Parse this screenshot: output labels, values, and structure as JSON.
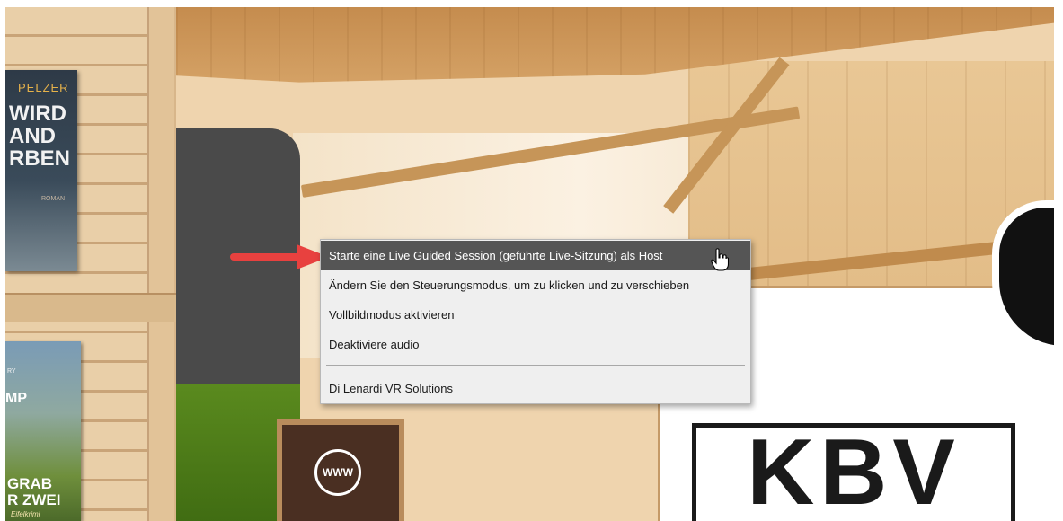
{
  "context_menu": {
    "items": [
      {
        "label": "Starte eine Live Guided Session (geführte Live-Sitzung) als Host",
        "highlighted": true
      },
      {
        "label": "Ändern Sie den Steuerungsmodus, um zu klicken und zu verschieben",
        "highlighted": false
      },
      {
        "label": "Vollbildmodus aktivieren",
        "highlighted": false
      },
      {
        "label": "Deaktiviere audio",
        "highlighted": false
      },
      {
        "label": "Di Lenardi VR Solutions",
        "highlighted": false
      }
    ]
  },
  "scene": {
    "book_top": {
      "author": "PELZER",
      "title": "WIRD\nAND\nRBEN",
      "subtitle": "ROMAN"
    },
    "book_bottom": {
      "top_text": "RY",
      "mid_text": "MP",
      "title": "GRAB\nR ZWEI",
      "subtitle": "Eifelkrimi"
    },
    "sign_icon_text": "WWW",
    "logo_text": "KBV"
  },
  "colors": {
    "arrow": "#e8413f",
    "menu_highlight": "#555555",
    "menu_background": "#efefef"
  }
}
